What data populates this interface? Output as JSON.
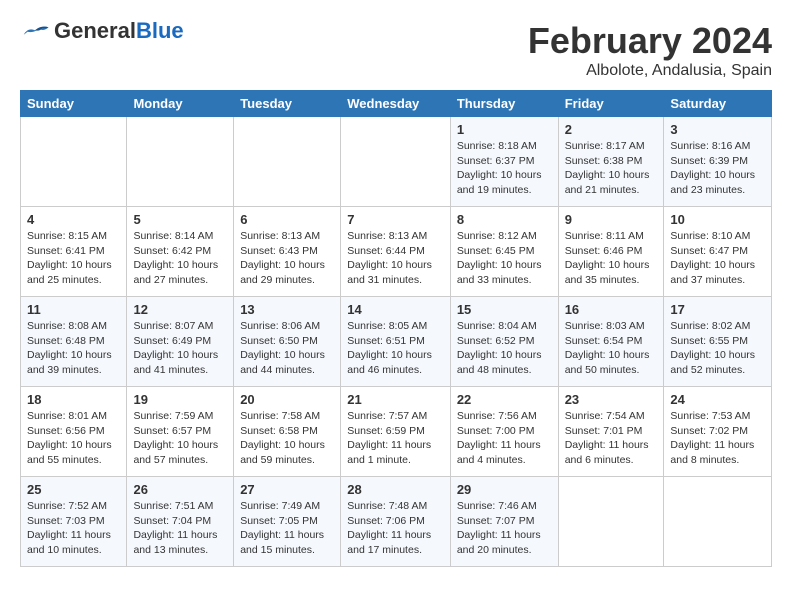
{
  "logo": {
    "general": "General",
    "blue": "Blue"
  },
  "title": "February 2024",
  "subtitle": "Albolote, Andalusia, Spain",
  "calendar": {
    "headers": [
      "Sunday",
      "Monday",
      "Tuesday",
      "Wednesday",
      "Thursday",
      "Friday",
      "Saturday"
    ],
    "rows": [
      [
        {
          "day": "",
          "info": ""
        },
        {
          "day": "",
          "info": ""
        },
        {
          "day": "",
          "info": ""
        },
        {
          "day": "",
          "info": ""
        },
        {
          "day": "1",
          "info": "Sunrise: 8:18 AM\nSunset: 6:37 PM\nDaylight: 10 hours\nand 19 minutes."
        },
        {
          "day": "2",
          "info": "Sunrise: 8:17 AM\nSunset: 6:38 PM\nDaylight: 10 hours\nand 21 minutes."
        },
        {
          "day": "3",
          "info": "Sunrise: 8:16 AM\nSunset: 6:39 PM\nDaylight: 10 hours\nand 23 minutes."
        }
      ],
      [
        {
          "day": "4",
          "info": "Sunrise: 8:15 AM\nSunset: 6:41 PM\nDaylight: 10 hours\nand 25 minutes."
        },
        {
          "day": "5",
          "info": "Sunrise: 8:14 AM\nSunset: 6:42 PM\nDaylight: 10 hours\nand 27 minutes."
        },
        {
          "day": "6",
          "info": "Sunrise: 8:13 AM\nSunset: 6:43 PM\nDaylight: 10 hours\nand 29 minutes."
        },
        {
          "day": "7",
          "info": "Sunrise: 8:13 AM\nSunset: 6:44 PM\nDaylight: 10 hours\nand 31 minutes."
        },
        {
          "day": "8",
          "info": "Sunrise: 8:12 AM\nSunset: 6:45 PM\nDaylight: 10 hours\nand 33 minutes."
        },
        {
          "day": "9",
          "info": "Sunrise: 8:11 AM\nSunset: 6:46 PM\nDaylight: 10 hours\nand 35 minutes."
        },
        {
          "day": "10",
          "info": "Sunrise: 8:10 AM\nSunset: 6:47 PM\nDaylight: 10 hours\nand 37 minutes."
        }
      ],
      [
        {
          "day": "11",
          "info": "Sunrise: 8:08 AM\nSunset: 6:48 PM\nDaylight: 10 hours\nand 39 minutes."
        },
        {
          "day": "12",
          "info": "Sunrise: 8:07 AM\nSunset: 6:49 PM\nDaylight: 10 hours\nand 41 minutes."
        },
        {
          "day": "13",
          "info": "Sunrise: 8:06 AM\nSunset: 6:50 PM\nDaylight: 10 hours\nand 44 minutes."
        },
        {
          "day": "14",
          "info": "Sunrise: 8:05 AM\nSunset: 6:51 PM\nDaylight: 10 hours\nand 46 minutes."
        },
        {
          "day": "15",
          "info": "Sunrise: 8:04 AM\nSunset: 6:52 PM\nDaylight: 10 hours\nand 48 minutes."
        },
        {
          "day": "16",
          "info": "Sunrise: 8:03 AM\nSunset: 6:54 PM\nDaylight: 10 hours\nand 50 minutes."
        },
        {
          "day": "17",
          "info": "Sunrise: 8:02 AM\nSunset: 6:55 PM\nDaylight: 10 hours\nand 52 minutes."
        }
      ],
      [
        {
          "day": "18",
          "info": "Sunrise: 8:01 AM\nSunset: 6:56 PM\nDaylight: 10 hours\nand 55 minutes."
        },
        {
          "day": "19",
          "info": "Sunrise: 7:59 AM\nSunset: 6:57 PM\nDaylight: 10 hours\nand 57 minutes."
        },
        {
          "day": "20",
          "info": "Sunrise: 7:58 AM\nSunset: 6:58 PM\nDaylight: 10 hours\nand 59 minutes."
        },
        {
          "day": "21",
          "info": "Sunrise: 7:57 AM\nSunset: 6:59 PM\nDaylight: 11 hours\nand 1 minute."
        },
        {
          "day": "22",
          "info": "Sunrise: 7:56 AM\nSunset: 7:00 PM\nDaylight: 11 hours\nand 4 minutes."
        },
        {
          "day": "23",
          "info": "Sunrise: 7:54 AM\nSunset: 7:01 PM\nDaylight: 11 hours\nand 6 minutes."
        },
        {
          "day": "24",
          "info": "Sunrise: 7:53 AM\nSunset: 7:02 PM\nDaylight: 11 hours\nand 8 minutes."
        }
      ],
      [
        {
          "day": "25",
          "info": "Sunrise: 7:52 AM\nSunset: 7:03 PM\nDaylight: 11 hours\nand 10 minutes."
        },
        {
          "day": "26",
          "info": "Sunrise: 7:51 AM\nSunset: 7:04 PM\nDaylight: 11 hours\nand 13 minutes."
        },
        {
          "day": "27",
          "info": "Sunrise: 7:49 AM\nSunset: 7:05 PM\nDaylight: 11 hours\nand 15 minutes."
        },
        {
          "day": "28",
          "info": "Sunrise: 7:48 AM\nSunset: 7:06 PM\nDaylight: 11 hours\nand 17 minutes."
        },
        {
          "day": "29",
          "info": "Sunrise: 7:46 AM\nSunset: 7:07 PM\nDaylight: 11 hours\nand 20 minutes."
        },
        {
          "day": "",
          "info": ""
        },
        {
          "day": "",
          "info": ""
        }
      ]
    ]
  }
}
